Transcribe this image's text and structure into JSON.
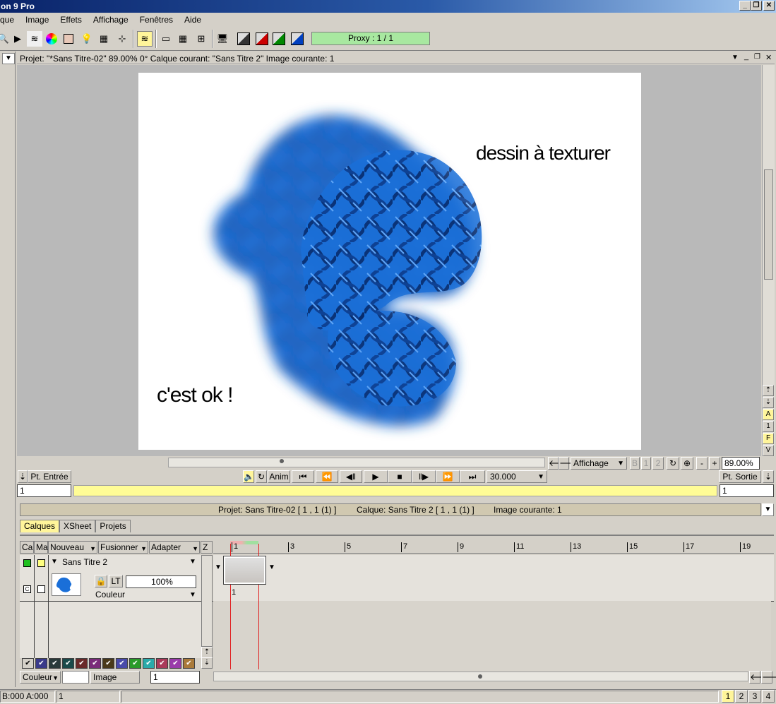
{
  "window": {
    "title": "on 9 Pro",
    "controls": [
      "_",
      "❐",
      "✕"
    ]
  },
  "menu": [
    "que",
    "Image",
    "Effets",
    "Affichage",
    "Fenêtres",
    "Aide"
  ],
  "toolbar": {
    "proxy": "Proxy : 1 / 1"
  },
  "viewer": {
    "info": "Projet:  \"*Sans Titre-02\"   89.00%   0°  Calque courant: \"Sans Titre 2\"  Image courante: 1",
    "canvas_text_1": "dessin à texturer",
    "canvas_text_2": "c'est ok !",
    "side_buttons": [
      "A",
      "1",
      "F",
      "V"
    ],
    "affichage": "Affichage",
    "zoom_minus": "-",
    "zoom_plus": "+",
    "zoom": "89.00%",
    "frame_btns": [
      "1",
      "2"
    ]
  },
  "transport": {
    "in_point": "Pt. Entrée",
    "out_point": "Pt. Sortie",
    "anim": "Anim",
    "fps": "30.000",
    "in_value": "1",
    "out_value": "1"
  },
  "lower": {
    "header": {
      "projet": "Projet: Sans Titre-02 [ 1 ,  1   (1) ]",
      "calque": "Calque: Sans Titre 2 [ 1 ,  1   (1) ]",
      "image": "Image courante: 1"
    },
    "tabs": [
      "Calques",
      "XSheet",
      "Projets"
    ],
    "columns": {
      "ca": "Ca",
      "ma": "Ma",
      "nouveau": "Nouveau",
      "fusionner": "Fusionner",
      "adapter": "Adapter",
      "z": "Z"
    },
    "ruler_labels": [
      "1",
      "3",
      "5",
      "7",
      "9",
      "11",
      "13",
      "15",
      "17",
      "19"
    ],
    "layer": {
      "name": "Sans Titre 2",
      "lock": "LT",
      "opacity": "100%",
      "mode": "Couleur",
      "frame": "1"
    },
    "footer": {
      "couleur": "Couleur",
      "image": "Image",
      "value": "1"
    },
    "swatch_colors": [
      "#3a3a8a",
      "#2a3a3a",
      "#1a4a4a",
      "#6a2a2a",
      "#7a2a7a",
      "#4a3a1a",
      "#4a4aaa",
      "#2a9a2a",
      "#2aaaaa",
      "#aa3a5a",
      "#9a3aaa",
      "#aa7a3a"
    ]
  },
  "status": {
    "coords": "B:000 A:000",
    "field": "1",
    "pages": [
      "1",
      "2",
      "3",
      "4"
    ]
  }
}
